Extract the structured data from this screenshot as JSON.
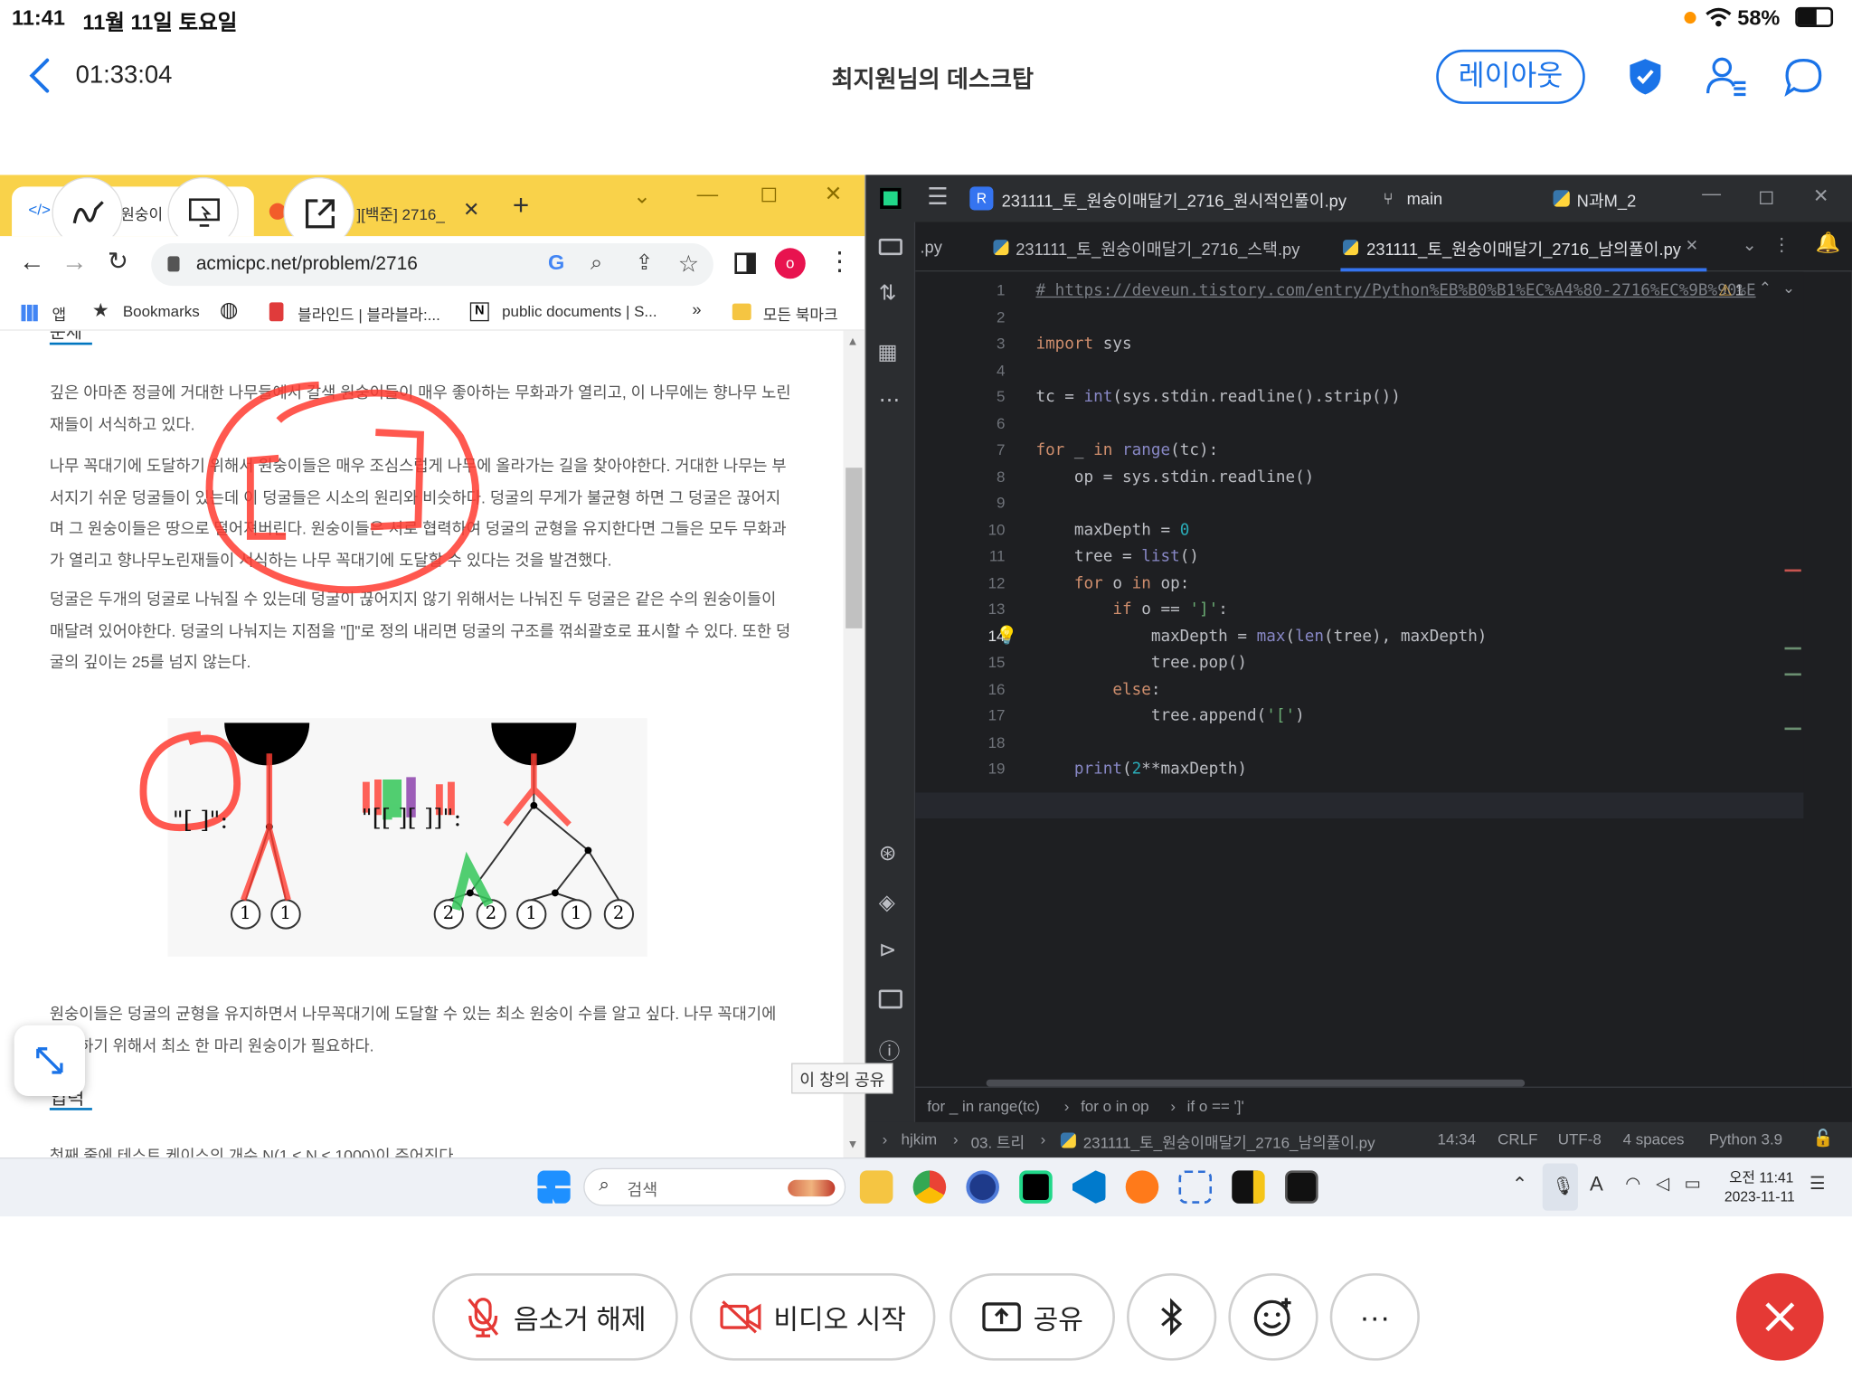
{
  "status": {
    "time": "11:41",
    "date": "11월 11일 토요일",
    "battery": "58%"
  },
  "meeting": {
    "elapsed": "01:33:04",
    "title": "최지원님의 데스크탑",
    "layout_label": "레이아웃"
  },
  "chrome": {
    "tabs": [
      {
        "label": "원숭이"
      },
      {
        "label": "][백준] 2716_"
      }
    ],
    "url": "acmicpc.net/problem/2716",
    "bookmarks": [
      "앱",
      "Bookmarks",
      "블라인드 | 블라블라:...",
      "public documents | S...",
      "»",
      "모든 북마크"
    ],
    "problem": {
      "heading_top": "문제",
      "p1": "깊은 아마존 정글에 거대한 나무들에서 갈색 원숭이들이 매우 좋아하는 무화과가 열리고, 이 나무에는 향나무 노린재들이 서식하고 있다.",
      "p2": "나무 꼭대기에 도달하기 위해서 원숭이들은 매우 조심스럽게 나무에 올라가는 길을 찾아야한다. 거대한 나무는 부서지기 쉬운 덩굴들이 있는데 이 덩굴들은 시소의 원리와 비슷하다. 덩굴의 무게가 불균형 하면 그 덩굴은 끊어지며 그 원숭이들은 땅으로 떨어져버린다. 원숭이들은 서로 협력하여 덩굴의 균형을 유지한다면 그들은 모두 무화과가 열리고 향나무노린재들이 서식하는 나무 꼭대기에 도달할 수 있다는 것을 발견했다.",
      "p3": "덩굴은 두개의 덩굴로 나눠질 수 있는데 덩굴이 끊어지지 않기 위해서는 나눠진 두 덩굴은 같은 수의 원숭이들이 매달려 있어야한다. 덩굴의 나눠지는 지점을 \"[]\"로 정의 내리면 덩굴의 구조를 꺾쇠괄호로 표시할 수 있다. 또한 덩굴의 깊이는 25를 넘지 않는다.",
      "p4": "원숭이들은 덩굴의 균형을 유지하면서 나무꼭대기에 도달할 수 있는 최소 원숭이 수를 알고 싶다. 나무 꼭대기에 도달하기 위해서 최소 한 마리 원숭이가 필요하다.",
      "heading_input": "입력",
      "p5": "첫째 줄에 테스트 케이스의 개수 N(1 ≤ N ≤ 1000)이 주어진다.",
      "fig_left_label": "\"[ ]\":",
      "fig_right_label": "\"[[ ][ ]]\":",
      "nodes_left": [
        "1",
        "1"
      ],
      "nodes_right": [
        "2",
        "2",
        "1",
        "1",
        "2"
      ]
    },
    "share_tooltip": "이 창의 공유"
  },
  "pycharm": {
    "project_badge": "R",
    "project_file": "231111_토_원숭이매달기_2716_원시적인풀이.py",
    "branch": "main",
    "run_config": "N과M_2",
    "tabs": [
      ".py",
      "231111_토_원숭이매달기_2716_스택.py",
      "231111_토_원숭이매달기_2716_남의풀이.py"
    ],
    "warning_count": "1",
    "breadcrumb": [
      "for _ in range(tc)",
      "for o in op",
      "if o == ']'"
    ],
    "status_path": [
      "hjkim",
      "03. 트리",
      "231111_토_원숭이매달기_2716_남의풀이.py"
    ],
    "status_info": [
      "14:34",
      "CRLF",
      "UTF-8",
      "4 spaces",
      "Python 3.9"
    ],
    "line_numbers": [
      "1",
      "2",
      "3",
      "4",
      "5",
      "6",
      "7",
      "8",
      "9",
      "10",
      "11",
      "12",
      "13",
      "14",
      "15",
      "16",
      "17",
      "18",
      "19"
    ],
    "code": {
      "l1": "# https://deveun.tistory.com/entry/Python%EB%B0%B1%EC%A4%80-2716%EC%9B%90%E",
      "l3a": "import",
      "l3b": " sys",
      "l5a": "tc = ",
      "l5b": "int",
      "l5c": "(sys.stdin.readline().strip())",
      "l7a": "for",
      "l7b": " _ ",
      "l7c": "in",
      "l7d": " ",
      "l7e": "range",
      "l7f": "(tc):",
      "l8": "    op = sys.stdin.readline()",
      "l10a": "    maxDepth = ",
      "l10b": "0",
      "l11a": "    tree = ",
      "l11b": "list",
      "l11c": "()",
      "l12a": "    ",
      "l12b": "for",
      "l12c": " o ",
      "l12d": "in",
      "l12e": " op:",
      "l13a": "        ",
      "l13b": "if",
      "l13c": " o == ",
      "l13d": "']'",
      "l13e": ":",
      "l14a": "            maxDepth = ",
      "l14b": "max",
      "l14c": "(",
      "l14d": "len",
      "l14e": "(tree), maxDepth)",
      "l15": "            tree.pop()",
      "l16a": "        ",
      "l16b": "else",
      "l16c": ":",
      "l17a": "            tree.append(",
      "l17b": "'['",
      "l17c": ")",
      "l19a": "    ",
      "l19b": "print",
      "l19c": "(",
      "l19d": "2",
      "l19e": "**maxDepth)"
    }
  },
  "taskbar": {
    "search_placeholder": "검색",
    "time": "오전 11:41",
    "date": "2023-11-11"
  },
  "controls": {
    "unmute": "음소거 해제",
    "start_video": "비디오 시작",
    "share": "공유"
  },
  "colors": {
    "accent": "#1a73e8",
    "annotation": "#ff3b30",
    "annotation_green": "#34c759",
    "annotation_purple": "#8e44ad",
    "end_button": "#e53935"
  }
}
